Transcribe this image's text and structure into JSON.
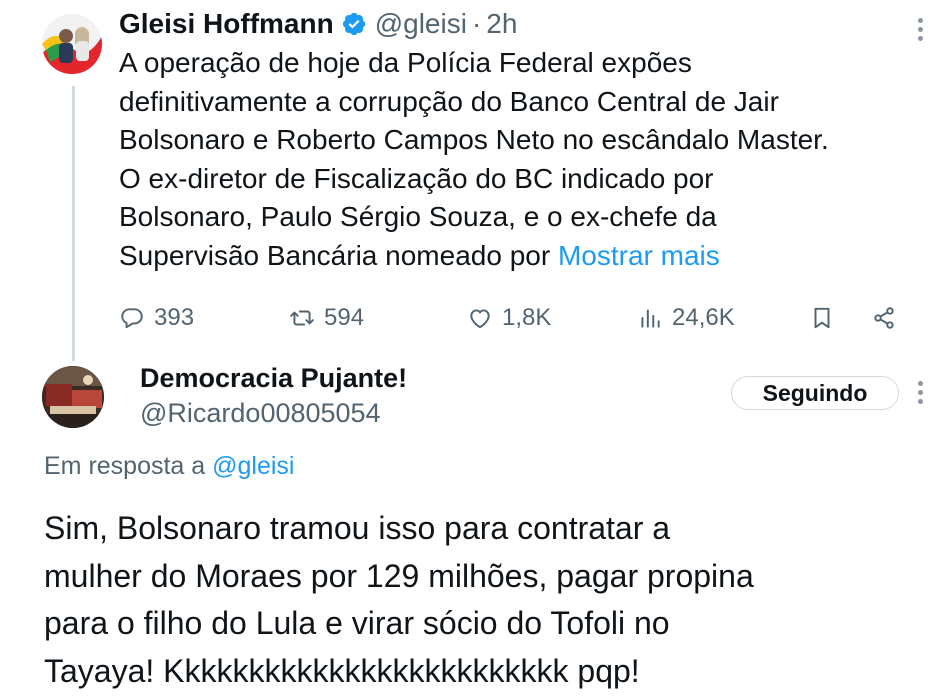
{
  "parent_tweet": {
    "author_name": "Gleisi Hoffmann",
    "handle": "@gleisi",
    "separator": "·",
    "time": "2h",
    "verified": true,
    "text_lines": [
      "A operação de hoje da Polícia Federal expões",
      "definitivamente a corrupção do Banco Central de Jair",
      "Bolsonaro e Roberto Campos Neto no escândalo Master.",
      "O ex-diretor de Fiscalização do BC indicado por",
      "Bolsonaro, Paulo Sérgio Souza, e o ex-chefe da",
      "Supervisão Bancária nomeado por "
    ],
    "show_more": "Mostrar mais",
    "stats": {
      "replies": "393",
      "retweets": "594",
      "likes": "1,8K",
      "views": "24,6K"
    }
  },
  "reply_tweet": {
    "author_name": "Democracia Pujante!",
    "handle": "@Ricardo00805054",
    "follow_button": "Seguindo",
    "reply_to_prefix": "Em resposta a ",
    "reply_to_handle": "@gleisi",
    "text_lines": [
      "Sim, Bolsonaro tramou isso para contratar a",
      "mulher do Moraes por 129 milhões, pagar propina",
      "para o filho do Lula e virar sócio do Tofoli no",
      "Tayaya! Kkkkkkkkkkkkkkkkkkkkkkkkk pqp!"
    ]
  },
  "colors": {
    "text": "#0f1419",
    "secondary": "#536471",
    "link": "#1d9bf0",
    "verified": "#1d9bf0",
    "thread_line": "#cfd9de"
  },
  "icons": [
    "reply-icon",
    "retweet-icon",
    "like-icon",
    "views-icon",
    "bookmark-icon",
    "share-icon",
    "verified-badge-icon",
    "more-options-icon"
  ]
}
